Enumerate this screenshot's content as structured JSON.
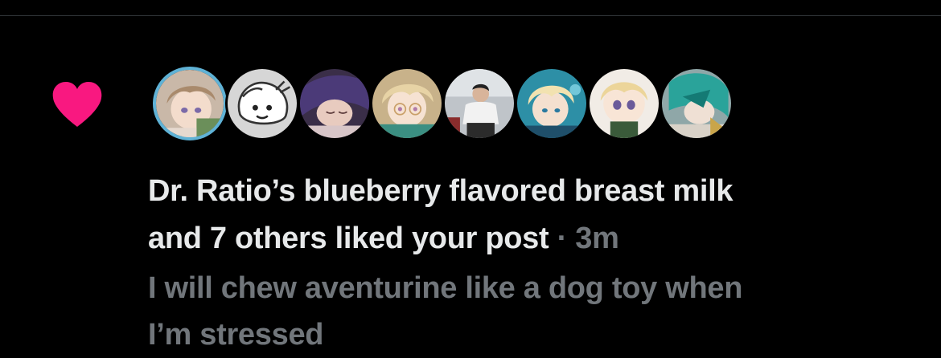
{
  "notification": {
    "type_icon": "heart-icon",
    "icon_color": "#f91880",
    "liker_name": "Dr. Ratio’s blueberry flavored breast milk",
    "action_text": "and 7 others liked your post",
    "separator": "·",
    "timestamp": "3m",
    "post_text_line1": "I will chew aventurine like a dog toy when",
    "post_text_line2": "I’m stressed",
    "avatars": [
      {
        "name": "avatar-1"
      },
      {
        "name": "avatar-2"
      },
      {
        "name": "avatar-3"
      },
      {
        "name": "avatar-4"
      },
      {
        "name": "avatar-5"
      },
      {
        "name": "avatar-6"
      },
      {
        "name": "avatar-7"
      },
      {
        "name": "avatar-8"
      }
    ]
  },
  "colors": {
    "background": "#000000",
    "primary_text": "#e7e9ea",
    "secondary_text": "#71767b",
    "like_pink": "#f91880",
    "divider": "#2f3336"
  }
}
